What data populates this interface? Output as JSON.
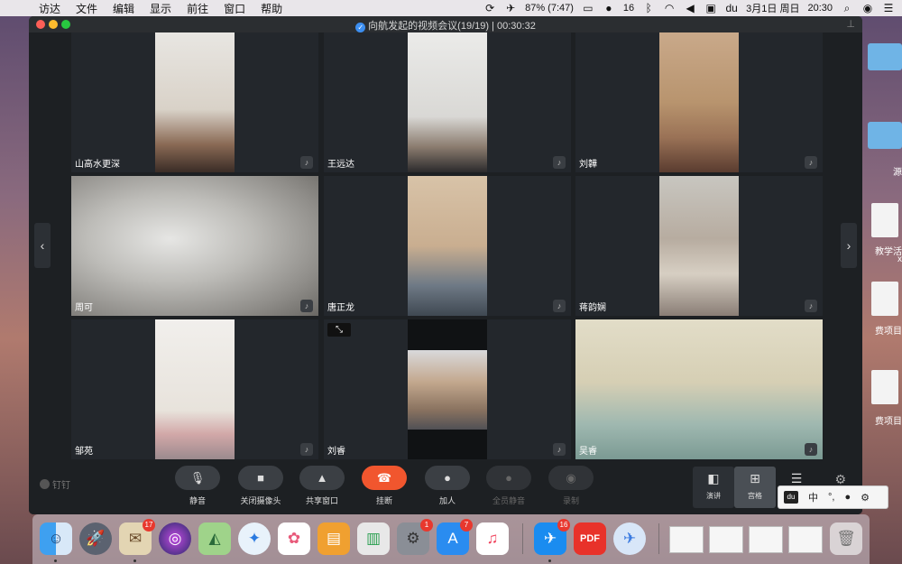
{
  "menubar": {
    "items": [
      "访达",
      "文件",
      "编辑",
      "显示",
      "前往",
      "窗口",
      "帮助"
    ],
    "battery": "87% (7:47)",
    "badge_count": "16",
    "date": "3月1日 周日",
    "time": "20:30"
  },
  "desktop": {
    "labels": [
      "源",
      "教学活",
      "x",
      "费项目",
      "费项目"
    ]
  },
  "window": {
    "title": "向航发起的视频会议(19/19) | 00:30:32"
  },
  "participants": [
    {
      "name": "山高水更深"
    },
    {
      "name": "王远达"
    },
    {
      "name": "刘韡"
    },
    {
      "name": "周可"
    },
    {
      "name": "唐正龙"
    },
    {
      "name": "蒋韵娴"
    },
    {
      "name": "邹苑"
    },
    {
      "name": "刘睿"
    },
    {
      "name": "吴睿"
    }
  ],
  "toolbar": {
    "brand": "钉钉",
    "buttons": [
      {
        "label": "静音",
        "icon": "mic-icon"
      },
      {
        "label": "关闭摄像头",
        "icon": "camera-icon"
      },
      {
        "label": "共享窗口",
        "icon": "share-screen-icon"
      },
      {
        "label": "挂断",
        "icon": "hangup-icon"
      },
      {
        "label": "加人",
        "icon": "add-person-icon"
      },
      {
        "label": "全员静音",
        "icon": "mute-all-icon"
      },
      {
        "label": "录制",
        "icon": "record-icon"
      }
    ],
    "views": [
      {
        "label": "演讲"
      },
      {
        "label": "宫格"
      }
    ]
  },
  "ime": {
    "logo": "du",
    "mode": "中",
    "punct": "°,"
  },
  "dock": {
    "mail_badge": "17",
    "prefs_badge": "1",
    "appstore_badge": "7",
    "dingtalk_badge": "16",
    "pdf_label": "PDF"
  }
}
